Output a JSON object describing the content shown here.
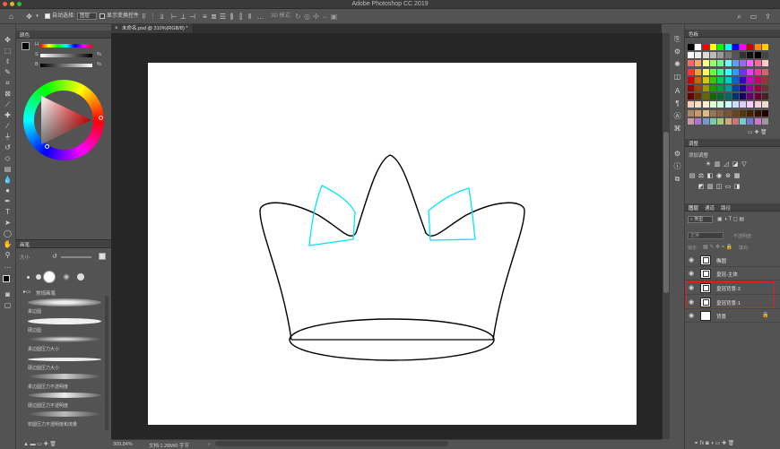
{
  "app": {
    "title": "Adobe Photoshop CC 2019"
  },
  "options_bar": {
    "auto_select_label": "自动选择:",
    "auto_select_value": "图层",
    "show_transform_label": "显示变换控件",
    "mode_3d_label": "3D 模式:"
  },
  "document": {
    "tab_label": "未命名.psd @ 310%(RGB/8) *",
    "zoom": "309.84%",
    "doc_size": "文档:1.28M/0 字节"
  },
  "color_panel": {
    "title": "颜色",
    "h_label": "H",
    "s_label": "S",
    "b_label": "B",
    "pct": "%"
  },
  "brush_panel": {
    "title": "画笔",
    "size_label": "大小",
    "group_label": "常规画笔",
    "brushes": [
      "柔边圆",
      "硬边圆",
      "柔边圆压力大小",
      "硬边圆压力大小",
      "柔边圆压力不透明度",
      "硬边圆压力不透明度",
      "软圆压力不透明度和流量"
    ]
  },
  "swatches_panel": {
    "title": "色板"
  },
  "adjustments_panel": {
    "title": "调整",
    "add_label": "添加调整"
  },
  "layers_panel": {
    "tabs": [
      "图层",
      "通道",
      "路径"
    ],
    "filter_kind": "类型",
    "blend_mode": "正常",
    "opacity_label": "不透明度:",
    "lock_label": "锁定:",
    "fill_label": "填充:",
    "layers": [
      {
        "name": "椭圆"
      },
      {
        "name": "皇冠-主体"
      },
      {
        "name": "皇冠背景-2"
      },
      {
        "name": "皇冠背景-1"
      },
      {
        "name": "背景"
      }
    ],
    "highlight_color": "#e02020"
  },
  "colors": {
    "accent_cyan": "#00e5ff",
    "ui_dark": "#535353"
  }
}
